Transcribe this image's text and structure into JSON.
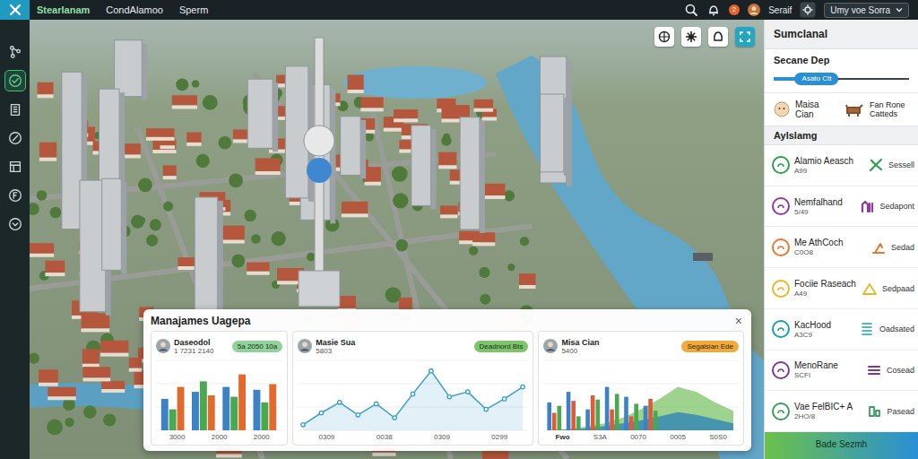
{
  "top_bar": {
    "menu": [
      {
        "label": "Stearlanam",
        "selected": true
      },
      {
        "label": "CondAlamoo",
        "selected": false
      },
      {
        "label": "Sperm",
        "selected": false
      }
    ],
    "notification_count": "2",
    "user": "Seraif",
    "workspace": "Umy voe Sorra"
  },
  "sidebar": {
    "items": [
      {
        "selected": false
      },
      {
        "selected": true
      },
      {
        "selected": false
      },
      {
        "selected": false
      },
      {
        "selected": false
      },
      {
        "selected": false
      },
      {
        "selected": false
      }
    ]
  },
  "right_panel": {
    "title": "Sumclanal",
    "scene": {
      "title": "Secane Dep",
      "slider": {
        "label": "Asato Ctt",
        "level": 0.48
      }
    },
    "scene_item": {
      "name": "Maisa Cian",
      "detail": "Fan Rone Catteds"
    },
    "section_title": "Aylslamg",
    "items": [
      {
        "name": "Alamio Aeasch",
        "code": "A99",
        "action": "Sessell",
        "color": "#2e9e4f"
      },
      {
        "name": "Nemfalhand",
        "code": "5/49",
        "action": "Sedapont",
        "color": "#8e3a9e"
      },
      {
        "name": "Me AthCoch",
        "code": "C0O8",
        "action": "Sedad",
        "color": "#e8772e"
      },
      {
        "name": "Fociie Raseach",
        "code": "A49",
        "action": "Sedpaad",
        "color": "#e6b820"
      },
      {
        "name": "KacHood",
        "code": "A3C9",
        "action": "Oadsated",
        "color": "#1c9db0"
      },
      {
        "name": "MenoRane",
        "code": "SCFI",
        "action": "Cosead",
        "color": "#7a3a8e"
      },
      {
        "name": "Vae FelBIC+ A",
        "code": "2HO/8",
        "action": "Pasead",
        "color": "#3a9e5a"
      }
    ],
    "button": "Bade Sezmh"
  },
  "manage_panel": {
    "title": "Manajames Uagepa",
    "close": "×",
    "cards": [
      {
        "kind": "bars",
        "title": "Daseodol",
        "subtitle": "1 7231 2140",
        "tag": "5a 2050 10a",
        "tag_color": "#8fd39a",
        "series": [
          {
            "color": "#3d82c4",
            "values": [
              45,
              55,
              62,
              58
            ]
          },
          {
            "color": "#4aa84e",
            "values": [
              30,
              70,
              48,
              40
            ]
          },
          {
            "color": "#e36a2e",
            "values": [
              62,
              50,
              80,
              66
            ]
          }
        ],
        "x_labels": [
          "3000",
          "2000",
          "2000"
        ]
      },
      {
        "kind": "line",
        "title": "Masie Sua",
        "subtitle": "5803",
        "tag": "Deadnord Bts",
        "tag_color": "#7cc66a",
        "series": [
          {
            "color": "#3aa0c8",
            "values": [
              8,
              25,
              40,
              22,
              38,
              18,
              52,
              85,
              48,
              55,
              30,
              45,
              62
            ]
          }
        ],
        "x_labels": [
          "0309",
          "0038",
          "0309",
          "0299"
        ]
      },
      {
        "kind": "combo",
        "title": "Misa Cian",
        "subtitle": "5400",
        "tag": "Segalsian Ede",
        "tag_color": "#f2a93a",
        "note": "Fwo",
        "series": [
          {
            "type": "area",
            "color": "#7cc36a",
            "values": [
              0,
              2,
              5,
              10,
              18,
              30,
              45,
              62,
              55,
              40,
              28
            ]
          },
          {
            "type": "area",
            "color": "#2a7fb8",
            "values": [
              0,
              1,
              3,
              6,
              10,
              14,
              20,
              26,
              22,
              16,
              10
            ]
          },
          {
            "type": "bar",
            "color": "#3d82c4",
            "values": [
              40,
              55,
              30,
              62,
              48,
              35
            ]
          },
          {
            "type": "bar",
            "color": "#e05a3a",
            "values": [
              25,
              42,
              50,
              30,
              20,
              45
            ]
          },
          {
            "type": "bar",
            "color": "#4aa84e",
            "values": [
              35,
              20,
              44,
              52,
              38,
              28
            ]
          }
        ],
        "x_labels": [
          "S3A",
          "0070",
          "0005",
          "S0S0"
        ]
      }
    ]
  }
}
